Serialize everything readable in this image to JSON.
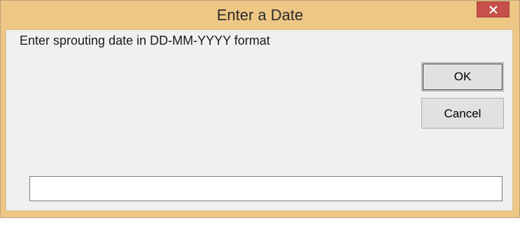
{
  "window": {
    "title": "Enter a Date",
    "close_icon": "close-icon"
  },
  "dialog": {
    "prompt": "Enter sprouting date in DD-MM-YYYY format",
    "ok_label": "OK",
    "cancel_label": "Cancel",
    "input_value": ""
  },
  "colors": {
    "titlebar": "#efc785",
    "close_button": "#c7504b",
    "client_background": "#f0f0f0",
    "button_face": "#e1e1e1"
  }
}
